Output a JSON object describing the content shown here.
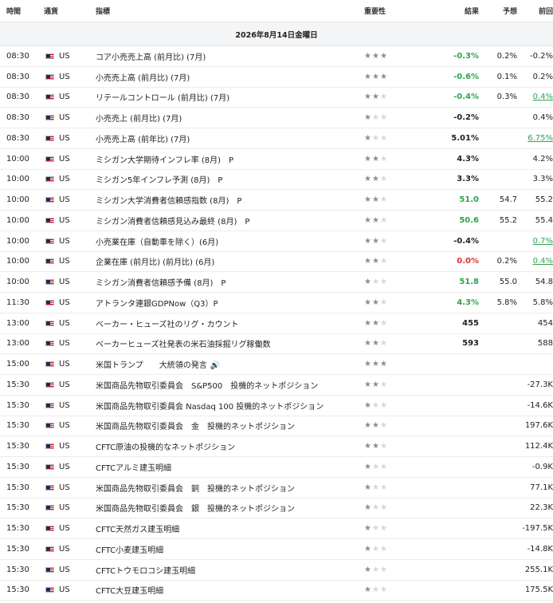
{
  "headers": {
    "time": "時間",
    "currency": "通貨",
    "indicator": "指標",
    "importance": "重要性",
    "actual": "結果",
    "forecast": "予想",
    "previous": "前回"
  },
  "date_label": "2026年8月14日金曜日",
  "rows": [
    {
      "time": "08:30",
      "cur": "US",
      "name": "コア小売売上高 (前月比) (7月)",
      "stars": 3,
      "actual": "-0.3%",
      "actual_color": "pos",
      "forecast": "0.2%",
      "prev": "-0.2%",
      "prev_style": ""
    },
    {
      "time": "08:30",
      "cur": "US",
      "name": "小売売上高 (前月比) (7月)",
      "stars": 3,
      "actual": "-0.6%",
      "actual_color": "pos",
      "forecast": "0.1%",
      "prev": "0.2%",
      "prev_style": ""
    },
    {
      "time": "08:30",
      "cur": "US",
      "name": "リテールコントロール (前月比) (7月)",
      "stars": 2,
      "actual": "-0.4%",
      "actual_color": "pos",
      "forecast": "0.3%",
      "prev": "0.4%",
      "prev_style": "up"
    },
    {
      "time": "08:30",
      "cur": "US",
      "name": "小売売上 (前月比) (7月)",
      "stars": 1,
      "actual": "-0.2%",
      "actual_color": "neu",
      "forecast": "",
      "prev": "0.4%",
      "prev_style": ""
    },
    {
      "time": "08:30",
      "cur": "US",
      "name": "小売売上高 (前年比) (7月)",
      "stars": 1,
      "actual": "5.01%",
      "actual_color": "neu",
      "forecast": "",
      "prev": "6.75%",
      "prev_style": "up"
    },
    {
      "time": "10:00",
      "cur": "US",
      "name": "ミシガン大学期待インフレ率 (8月)　P",
      "stars": 2,
      "actual": "4.3%",
      "actual_color": "neu",
      "forecast": "",
      "prev": "4.2%",
      "prev_style": ""
    },
    {
      "time": "10:00",
      "cur": "US",
      "name": "ミシガン5年インフレ予測 (8月)　P",
      "stars": 2,
      "actual": "3.3%",
      "actual_color": "neu",
      "forecast": "",
      "prev": "3.3%",
      "prev_style": ""
    },
    {
      "time": "10:00",
      "cur": "US",
      "name": "ミシガン大学消費者信頼感指数 (8月)　P",
      "stars": 2,
      "actual": "51.0",
      "actual_color": "pos",
      "forecast": "54.7",
      "prev": "55.2",
      "prev_style": ""
    },
    {
      "time": "10:00",
      "cur": "US",
      "name": "ミシガン消費者信頼感見込み最終 (8月)　P",
      "stars": 2,
      "actual": "50.6",
      "actual_color": "pos",
      "forecast": "55.2",
      "prev": "55.4",
      "prev_style": ""
    },
    {
      "time": "10:00",
      "cur": "US",
      "name": "小売業在庫（自動車を除く）(6月)",
      "stars": 2,
      "actual": "-0.4%",
      "actual_color": "neu",
      "forecast": "",
      "prev": "0.7%",
      "prev_style": "up"
    },
    {
      "time": "10:00",
      "cur": "US",
      "name": "企業在庫 (前月比) (前月比) (6月)",
      "stars": 2,
      "actual": "0.0%",
      "actual_color": "neg",
      "forecast": "0.2%",
      "prev": "0.4%",
      "prev_style": "up"
    },
    {
      "time": "10:00",
      "cur": "US",
      "name": "ミシガン消費者信頼感予備 (8月)　P",
      "stars": 1,
      "actual": "51.8",
      "actual_color": "pos",
      "forecast": "55.0",
      "prev": "54.8",
      "prev_style": ""
    },
    {
      "time": "11:30",
      "cur": "US",
      "name": "アトランタ連銀GDPNow（Q3）P",
      "stars": 2,
      "actual": "4.3%",
      "actual_color": "pos",
      "forecast": "5.8%",
      "prev": "5.8%",
      "prev_style": ""
    },
    {
      "time": "13:00",
      "cur": "US",
      "name": "ベーカー・ヒューズ社のリグ・カウント",
      "stars": 2,
      "actual": "455",
      "actual_color": "neu",
      "forecast": "",
      "prev": "454",
      "prev_style": ""
    },
    {
      "time": "13:00",
      "cur": "US",
      "name": "ベーカーヒューズ社発表の米石油採掘リグ稼働数",
      "stars": 2,
      "actual": "593",
      "actual_color": "neu",
      "forecast": "",
      "prev": "588",
      "prev_style": ""
    },
    {
      "time": "15:00",
      "cur": "US",
      "name": "米国トランプ　　大統領の発言",
      "stars": 3,
      "actual": "",
      "actual_color": "neu",
      "forecast": "",
      "prev": "",
      "prev_style": "",
      "speaker": true
    },
    {
      "time": "15:30",
      "cur": "US",
      "name": "米国商品先物取引委員会　S&P500　投機的ネットポジション",
      "stars": 2,
      "actual": "",
      "actual_color": "neu",
      "forecast": "",
      "prev": "-27.3K",
      "prev_style": ""
    },
    {
      "time": "15:30",
      "cur": "US",
      "name": "米国商品先物取引委員会 Nasdaq 100 投機的ネットポジション",
      "stars": 1,
      "actual": "",
      "actual_color": "neu",
      "forecast": "",
      "prev": "-14.6K",
      "prev_style": ""
    },
    {
      "time": "15:30",
      "cur": "US",
      "name": "米国商品先物取引委員会　金　投機的ネットポジション",
      "stars": 2,
      "actual": "",
      "actual_color": "neu",
      "forecast": "",
      "prev": "197.6K",
      "prev_style": ""
    },
    {
      "time": "15:30",
      "cur": "US",
      "name": "CFTC原油の投機的なネットポジション",
      "stars": 2,
      "actual": "",
      "actual_color": "neu",
      "forecast": "",
      "prev": "112.4K",
      "prev_style": ""
    },
    {
      "time": "15:30",
      "cur": "US",
      "name": "CFTCアルミ建玉明細",
      "stars": 1,
      "actual": "",
      "actual_color": "neu",
      "forecast": "",
      "prev": "-0.9K",
      "prev_style": ""
    },
    {
      "time": "15:30",
      "cur": "US",
      "name": "米国商品先物取引委員会　銅　投機的ネットポジション",
      "stars": 1,
      "actual": "",
      "actual_color": "neu",
      "forecast": "",
      "prev": "77.1K",
      "prev_style": ""
    },
    {
      "time": "15:30",
      "cur": "US",
      "name": "米国商品先物取引委員会　銀　投機的ネットポジション",
      "stars": 1,
      "actual": "",
      "actual_color": "neu",
      "forecast": "",
      "prev": "22.3K",
      "prev_style": ""
    },
    {
      "time": "15:30",
      "cur": "US",
      "name": "CFTC天然ガス建玉明細",
      "stars": 1,
      "actual": "",
      "actual_color": "neu",
      "forecast": "",
      "prev": "-197.5K",
      "prev_style": ""
    },
    {
      "time": "15:30",
      "cur": "US",
      "name": "CFTC小麦建玉明細",
      "stars": 1,
      "actual": "",
      "actual_color": "neu",
      "forecast": "",
      "prev": "-14.8K",
      "prev_style": ""
    },
    {
      "time": "15:30",
      "cur": "US",
      "name": "CFTCトウモロコシ建玉明細",
      "stars": 1,
      "actual": "",
      "actual_color": "neu",
      "forecast": "",
      "prev": "255.1K",
      "prev_style": ""
    },
    {
      "time": "15:30",
      "cur": "US",
      "name": "CFTC大豆建玉明細",
      "stars": 1,
      "actual": "",
      "actual_color": "neu",
      "forecast": "",
      "prev": "175.5K",
      "prev_style": ""
    }
  ]
}
